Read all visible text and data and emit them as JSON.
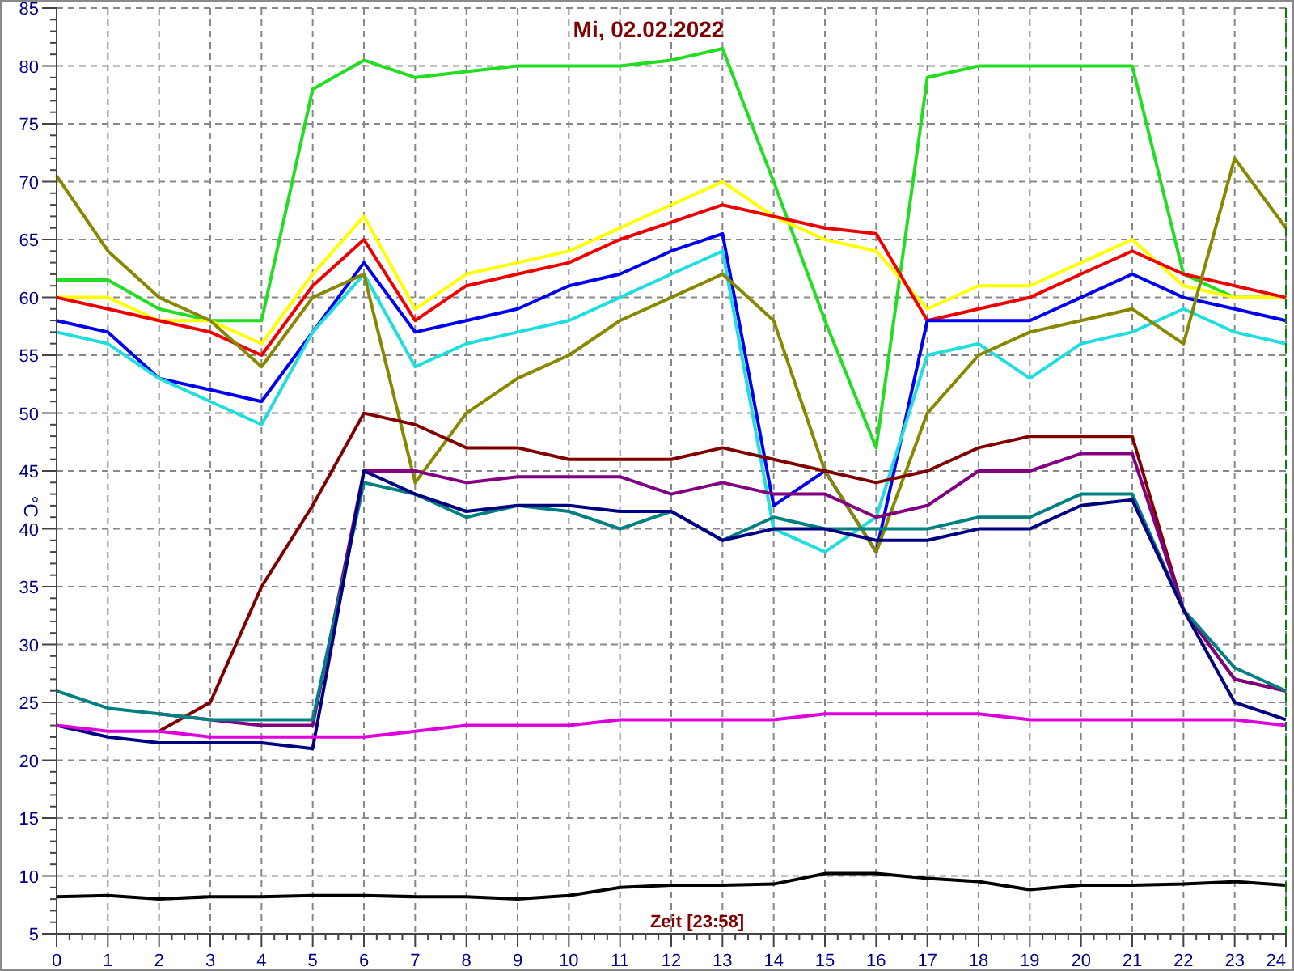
{
  "chart": {
    "chart_data": {
      "type": "line",
      "title": "Mi, 02.02.2022",
      "xlabel": "Zeit [23:58]",
      "ylabel": "°C",
      "x": [
        0,
        1,
        2,
        3,
        4,
        5,
        6,
        7,
        8,
        9,
        10,
        11,
        12,
        13,
        14,
        15,
        16,
        17,
        18,
        19,
        20,
        21,
        22,
        23,
        24
      ],
      "xlim": [
        0,
        24
      ],
      "grid": true,
      "ylim": [
        5,
        85
      ],
      "xticks": [
        0,
        1,
        2,
        3,
        4,
        5,
        6,
        7,
        8,
        9,
        10,
        11,
        12,
        13,
        14,
        15,
        16,
        17,
        18,
        19,
        20,
        21,
        22,
        23,
        24
      ],
      "yticks": [
        5,
        10,
        15,
        20,
        25,
        30,
        35,
        40,
        45,
        50,
        55,
        60,
        65,
        70,
        75,
        80,
        85
      ],
      "series": [
        {
          "color": "#22dd22",
          "values": [
            61.5,
            61.5,
            59,
            58,
            58,
            78,
            80.5,
            79,
            79.5,
            80,
            80,
            80,
            80.5,
            81.5,
            70,
            58,
            47,
            79,
            80,
            80,
            80,
            80,
            62,
            60,
            60
          ]
        },
        {
          "color": "#ffff00",
          "values": [
            60,
            60,
            58,
            58,
            56,
            62,
            67,
            59,
            62,
            63,
            64,
            66,
            68,
            70,
            67,
            65,
            64,
            59,
            61,
            61,
            63,
            65,
            61,
            60,
            60
          ]
        },
        {
          "color": "#ee0000",
          "values": [
            60,
            59,
            58,
            57,
            55,
            61,
            65,
            58,
            61,
            62,
            63,
            65,
            66.5,
            68,
            67,
            66,
            65.5,
            58,
            59,
            60,
            62,
            64,
            62,
            61,
            60
          ]
        },
        {
          "color": "#0000ee",
          "values": [
            58,
            57,
            53,
            52,
            51,
            57,
            63,
            57,
            58,
            59,
            61,
            62,
            64,
            65.5,
            42,
            45,
            38,
            58,
            58,
            58,
            60,
            62,
            60,
            59,
            58
          ]
        },
        {
          "color": "#22dddd",
          "values": [
            57,
            56,
            53,
            51,
            49,
            57,
            62,
            54,
            56,
            57,
            58,
            60,
            62,
            64,
            40,
            38,
            41,
            55,
            56,
            53,
            56,
            57,
            59,
            57,
            56
          ]
        },
        {
          "color": "#888800",
          "values": [
            70.5,
            64,
            60,
            58,
            54,
            60,
            62,
            44,
            50,
            53,
            55,
            58,
            60,
            62,
            58,
            45,
            38,
            50,
            55,
            57,
            58,
            59,
            56,
            72,
            66
          ]
        },
        {
          "color": "#800000",
          "values": [
            null,
            null,
            22.5,
            25,
            35,
            42,
            50,
            49,
            47,
            47,
            46,
            46,
            46,
            47,
            46,
            45,
            44,
            45,
            47,
            48,
            48,
            48,
            33,
            27,
            26
          ]
        },
        {
          "color": "#800080",
          "values": [
            null,
            null,
            24,
            23.5,
            23,
            23,
            45,
            45,
            44,
            44.5,
            44.5,
            44.5,
            43,
            44,
            43,
            43,
            41,
            42,
            45,
            45,
            46.5,
            46.5,
            33,
            27,
            26
          ]
        },
        {
          "color": "#008080",
          "values": [
            26,
            24.5,
            24,
            23.5,
            23.5,
            23.5,
            44,
            43,
            41,
            42,
            41.5,
            40,
            41.5,
            39,
            41,
            40,
            40,
            40,
            41,
            41,
            43,
            43,
            33,
            28,
            26
          ]
        },
        {
          "color": "#000080",
          "values": [
            23,
            22,
            21.5,
            21.5,
            21.5,
            21,
            45,
            43,
            41.5,
            42,
            42,
            41.5,
            41.5,
            39,
            40,
            40,
            39,
            39,
            40,
            40,
            42,
            42.5,
            33,
            25,
            23.5
          ]
        },
        {
          "color": "#dd00dd",
          "values": [
            23,
            22.5,
            22.5,
            22,
            22,
            22,
            22,
            22.5,
            23,
            23,
            23,
            23.5,
            23.5,
            23.5,
            23.5,
            24,
            24,
            24,
            24,
            23.5,
            23.5,
            23.5,
            23.5,
            23.5,
            23
          ]
        },
        {
          "color": "#000000",
          "values": [
            8.2,
            8.3,
            8,
            8.2,
            8.2,
            8.3,
            8.3,
            8.2,
            8.2,
            8,
            8.3,
            9,
            9.2,
            9.2,
            9.3,
            10.2,
            10.2,
            9.8,
            9.5,
            8.8,
            9.2,
            9.2,
            9.3,
            9.5,
            9.2
          ]
        }
      ]
    }
  }
}
